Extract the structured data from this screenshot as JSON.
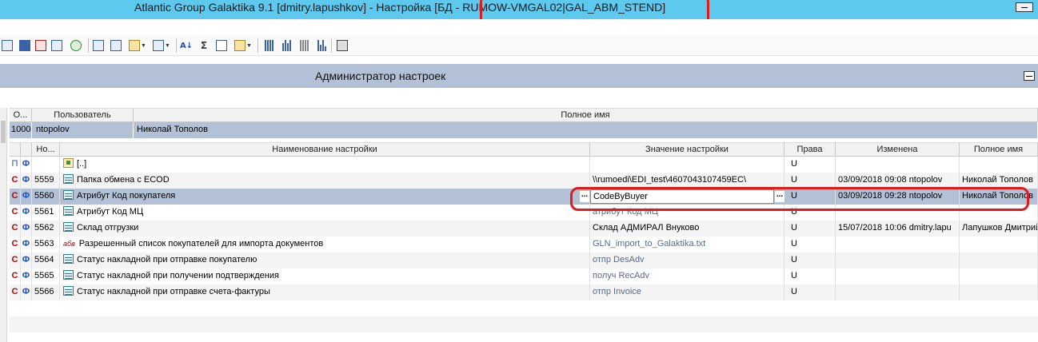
{
  "window": {
    "title": "Atlantic Group Galaktika 9.1 [dmitry.lapushkov] - Настройка [БД - RUMOW-VMGAL02|GAL_ABM_STEND]"
  },
  "toolbar": {
    "icons": [
      "calculator-icon",
      "help-icon",
      "delete-icon",
      "window-icon",
      "refresh-icon",
      "copy-icon",
      "grid-icon",
      "export-icon",
      "copy2-icon",
      "sort-az-icon",
      "sum-icon",
      "settings-icon",
      "columns1-icon",
      "columns2-icon",
      "columns3-icon",
      "columns4-icon",
      "print-icon"
    ]
  },
  "panel": {
    "title": "Администратор настроек"
  },
  "users_grid": {
    "headers": [
      "О...",
      "Пользователь",
      "Полное имя"
    ],
    "row": {
      "id": "1000",
      "login": "ntopolov",
      "full_name": "Николай Тополов"
    }
  },
  "settings_grid": {
    "headers": [
      "Но...",
      "Наименование настройки",
      "Значение настройки",
      "Права",
      "Изменена",
      "Полное имя"
    ],
    "rows": [
      {
        "flag1": "П",
        "flag2": "Ф",
        "num": "",
        "icon": "folder-icon",
        "name": "[..]",
        "value": "",
        "rights": "U",
        "changed": "",
        "fullname": ""
      },
      {
        "flag1": "С",
        "flag2": "Ф",
        "num": "5559",
        "icon": "list-icon",
        "name": "Папка обмена с ECOD",
        "value": "\\\\rumoedi\\EDI_test\\4607043107459EC\\",
        "rights": "U",
        "changed": "03/09/2018 09:08 ntopolov",
        "fullname": "Николай Тополов"
      },
      {
        "flag1": "С",
        "flag2": "Ф",
        "num": "5560",
        "icon": "list-icon",
        "name": "Атрибут Код покупателя",
        "value": "CodeByBuyer",
        "rights": "U",
        "changed": "03/09/2018 09:28 ntopolov",
        "fullname": "Николай Тополов"
      },
      {
        "flag1": "С",
        "flag2": "Ф",
        "num": "5561",
        "icon": "list-icon",
        "name": "Атрибут Код МЦ",
        "value": "атрибут Код МЦ",
        "rights": "U",
        "changed": "",
        "fullname": ""
      },
      {
        "flag1": "С",
        "flag2": "Ф",
        "num": "5562",
        "icon": "list-icon",
        "name": "Склад отгрузки",
        "value": "Склад АДМИРАЛ Внуково",
        "rights": "U",
        "changed": "15/07/2018 10:06 dmitry.lapu",
        "fullname": "Лапушков Дмитрий"
      },
      {
        "flag1": "С",
        "flag2": "Ф",
        "num": "5563",
        "icon": "abc-icon",
        "name": "Разрешенный список покупателей для импорта документов",
        "value": "GLN_import_to_Galaktika.txt",
        "rights": "U",
        "changed": "",
        "fullname": ""
      },
      {
        "flag1": "С",
        "flag2": "Ф",
        "num": "5564",
        "icon": "list-icon",
        "name": "Статус накладной при отправке покупателю",
        "value": "отпр DesAdv",
        "rights": "U",
        "changed": "",
        "fullname": ""
      },
      {
        "flag1": "С",
        "flag2": "Ф",
        "num": "5565",
        "icon": "list-icon",
        "name": "Статус накладной при получении подтверждения",
        "value": "получ RecAdv",
        "rights": "U",
        "changed": "",
        "fullname": ""
      },
      {
        "flag1": "С",
        "flag2": "Ф",
        "num": "5566",
        "icon": "list-icon",
        "name": "Статус накладной при отправке счета-фактуры",
        "value": "отпр Invoice",
        "rights": "U",
        "changed": "",
        "fullname": ""
      }
    ],
    "abc_label": "абв",
    "ellipsis": "..."
  },
  "colors": {
    "title_bar": "#5ec9ef",
    "panel_header": "#b3c1d6",
    "selected_row": "#b3c1d6",
    "highlight": "#e01b1b"
  }
}
